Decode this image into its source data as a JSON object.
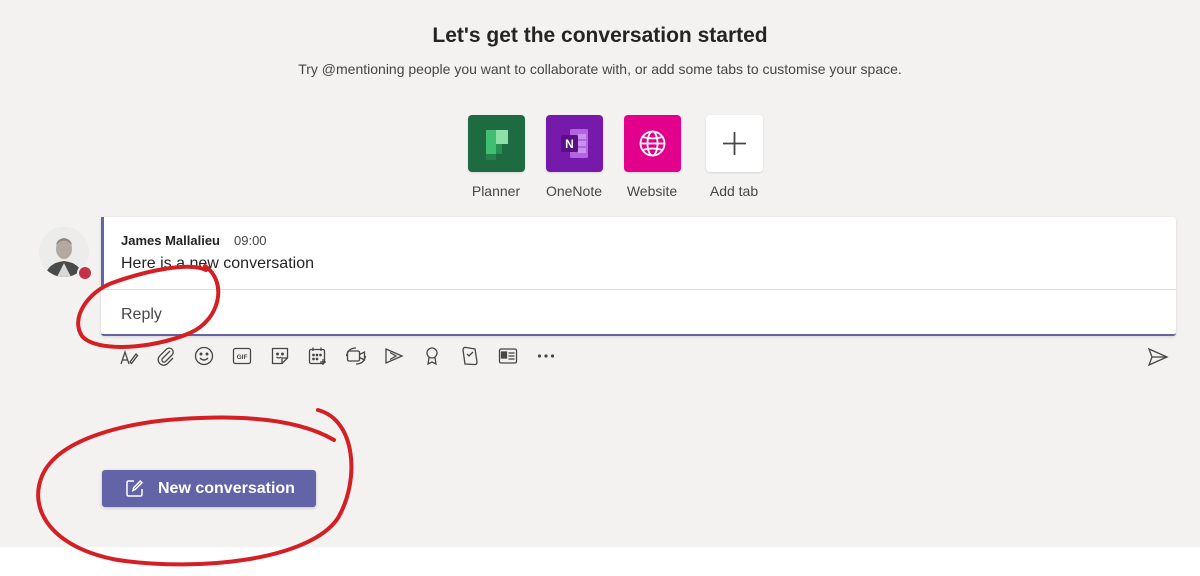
{
  "header": {
    "title": "Let's get the conversation started",
    "subtitle": "Try @mentioning people you want to collaborate with, or add some tabs to customise your space."
  },
  "apps": [
    {
      "label": "Planner",
      "icon": "planner-icon",
      "color": "#1e6b41"
    },
    {
      "label": "OneNote",
      "icon": "onenote-icon",
      "color": "#7719aa"
    },
    {
      "label": "Website",
      "icon": "globe-icon",
      "color": "#e3008c"
    },
    {
      "label": "Add tab",
      "icon": "plus-icon",
      "color": "#ffffff"
    }
  ],
  "message": {
    "author": "James Mallalieu",
    "time": "09:00",
    "text": "Here is a new conversation",
    "reply_label": "Reply",
    "presence_color": "#c4314b"
  },
  "toolbar_icons": [
    "format-icon",
    "attach-icon",
    "emoji-icon",
    "gif-icon",
    "sticker-icon",
    "meeting-icon",
    "video-icon",
    "stream-icon",
    "praise-icon",
    "approvals-icon",
    "forms-icon",
    "more-icon"
  ],
  "send_icon": "send-icon",
  "new_conversation": {
    "label": "New conversation",
    "icon": "compose-icon"
  },
  "colors": {
    "accent": "#6264a7",
    "background": "#f3f2f1",
    "annotation": "#d41f24"
  }
}
